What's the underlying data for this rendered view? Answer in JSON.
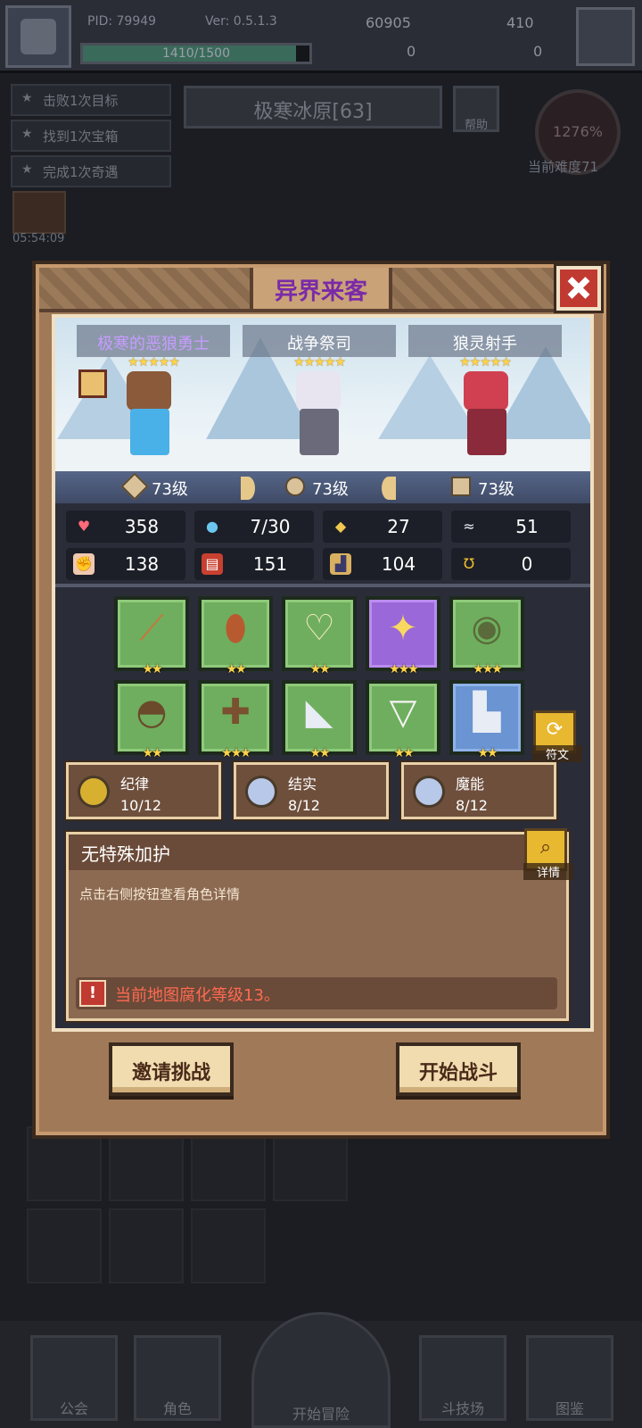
{
  "header": {
    "pid": "PID: 79949",
    "version": "Ver: 0.5.1.3",
    "xp_text": "1410/1500",
    "xp_fraction": 0.94,
    "currency_a": "60905",
    "currency_b": "410",
    "currency_c": "0",
    "currency_d": "0"
  },
  "quests": [
    "击败1次目标",
    "找到1次宝箱",
    "完成1次奇遇"
  ],
  "region": "极寒冰原[63]",
  "help_label": "帮助",
  "difficulty": {
    "percent": "1276%",
    "label": "当前难度71"
  },
  "timer": "05:54:09",
  "nav": {
    "guild": "公会",
    "role": "角色",
    "start_adventure": "开始冒险",
    "arena": "斗技场",
    "codex": "图鉴"
  },
  "modal": {
    "title": "异界来客",
    "heroes": [
      {
        "name": "极寒的恶狼勇士",
        "stars": "★★★★★",
        "level": "73级"
      },
      {
        "name": "战争祭司",
        "stars": "★★★★★",
        "level": "73级"
      },
      {
        "name": "狼灵射手",
        "stars": "★★★★★",
        "level": "73级"
      }
    ],
    "stats": [
      {
        "icon": "heart-icon",
        "value": "358"
      },
      {
        "icon": "droplet-icon",
        "value": "7/30"
      },
      {
        "icon": "shield-icon",
        "value": "27"
      },
      {
        "icon": "wing-icon",
        "value": "51"
      },
      {
        "icon": "fist-icon",
        "value": "138"
      },
      {
        "icon": "book-icon",
        "value": "151"
      },
      {
        "icon": "boot-icon",
        "value": "104"
      },
      {
        "icon": "horseshoe-icon",
        "value": "0"
      }
    ],
    "equipment": [
      {
        "icon": "sword-icon",
        "rarity": "green",
        "stars": "★★"
      },
      {
        "icon": "round-shield-icon",
        "rarity": "green",
        "stars": "★★"
      },
      {
        "icon": "necklace-icon",
        "rarity": "green",
        "stars": "★★"
      },
      {
        "icon": "golden-cross-icon",
        "rarity": "purple",
        "stars": "★★★"
      },
      {
        "icon": "amulet-icon",
        "rarity": "green",
        "stars": "★★★"
      },
      {
        "icon": "helmet-icon",
        "rarity": "green",
        "stars": "★★"
      },
      {
        "icon": "armor-icon",
        "rarity": "green",
        "stars": "★★★"
      },
      {
        "icon": "gauntlet-icon",
        "rarity": "green",
        "stars": "★★"
      },
      {
        "icon": "belt-icon",
        "rarity": "green",
        "stars": "★★"
      },
      {
        "icon": "boots-icon",
        "rarity": "blue",
        "stars": "★★"
      }
    ],
    "rune_label": "符文",
    "attributes": [
      {
        "name": "纪律",
        "value": "10/12",
        "color": "#d8b030"
      },
      {
        "name": "结实",
        "value": "8/12",
        "color": "#b8c8e8"
      },
      {
        "name": "魔能",
        "value": "8/12",
        "color": "#b8c8e8"
      }
    ],
    "desc_title": "无特殊加护",
    "desc_text": "点击右侧按钮查看角色详情",
    "warning": "当前地图腐化等级13。",
    "detail_label": "详情",
    "invite_button": "邀请挑战",
    "start_button": "开始战斗"
  }
}
